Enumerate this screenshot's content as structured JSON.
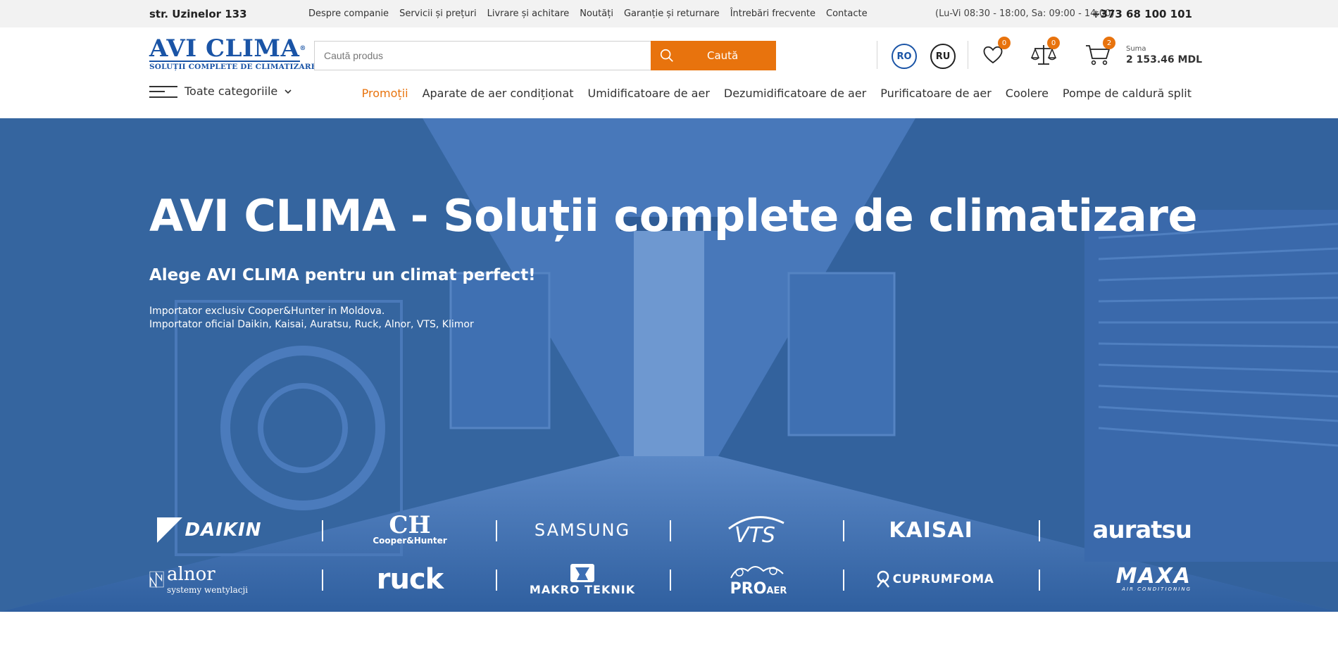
{
  "topbar": {
    "address": "str. Uzinelor 133",
    "nav": [
      "Despre companie",
      "Servicii și prețuri",
      "Livrare și achitare",
      "Noutăți",
      "Garanție și returnare",
      "Întrebări frecvente",
      "Contacte"
    ],
    "hours": "(Lu-Vi 08:30 - 18:00, Sa: 09:00 - 14:00)",
    "phone": "+373 68 100 101"
  },
  "header": {
    "logo_text": "AVI CLIMA",
    "logo_reg": "®",
    "logo_tagline": "SOLUȚII COMPLETE DE CLIMATIZARE",
    "search_placeholder": "Caută produs",
    "search_button": "Caută",
    "lang_ro": "RO",
    "lang_ru": "RU",
    "wishlist_count": "0",
    "compare_count": "0",
    "cart_count": "2",
    "sum_label": "Suma",
    "sum_value": "2 153.46 MDL"
  },
  "categories": {
    "all_label": "Toate categoriile",
    "menu": [
      "Promoții",
      "Aparate de aer condiționat",
      "Umidificatoare de aer",
      "Dezumidificatoare de aer",
      "Purificatoare de aer",
      "Coolere",
      "Pompe de caldură split"
    ]
  },
  "hero": {
    "title": "AVI CLIMA - Soluții complete de climatizare",
    "subtitle": "Alege AVI CLIMA pentru un climat perfect!",
    "line1": "Importator exclusiv Cooper&Hunter in Moldova.",
    "line2": "Importator oficial Daikin, Kaisai, Auratsu, Ruck, Alnor, VTS, Klimor"
  },
  "brands": {
    "row1": [
      "DAIKIN",
      "CH",
      "Cooper&Hunter",
      "SAMSUNG",
      "VTS",
      "KAISAI",
      "auratsu"
    ],
    "row2": [
      "alnor",
      "systemy wentylacji",
      "ruck",
      "MAKRO TEKNIK",
      "PRO",
      "AER",
      "CUPRUMFOMA",
      "MAXA",
      "AIR CONDITIONING"
    ]
  },
  "colors": {
    "brand_blue": "#1a54a6",
    "accent_orange": "#e8730d",
    "hero_blue": "#3b6db3"
  }
}
